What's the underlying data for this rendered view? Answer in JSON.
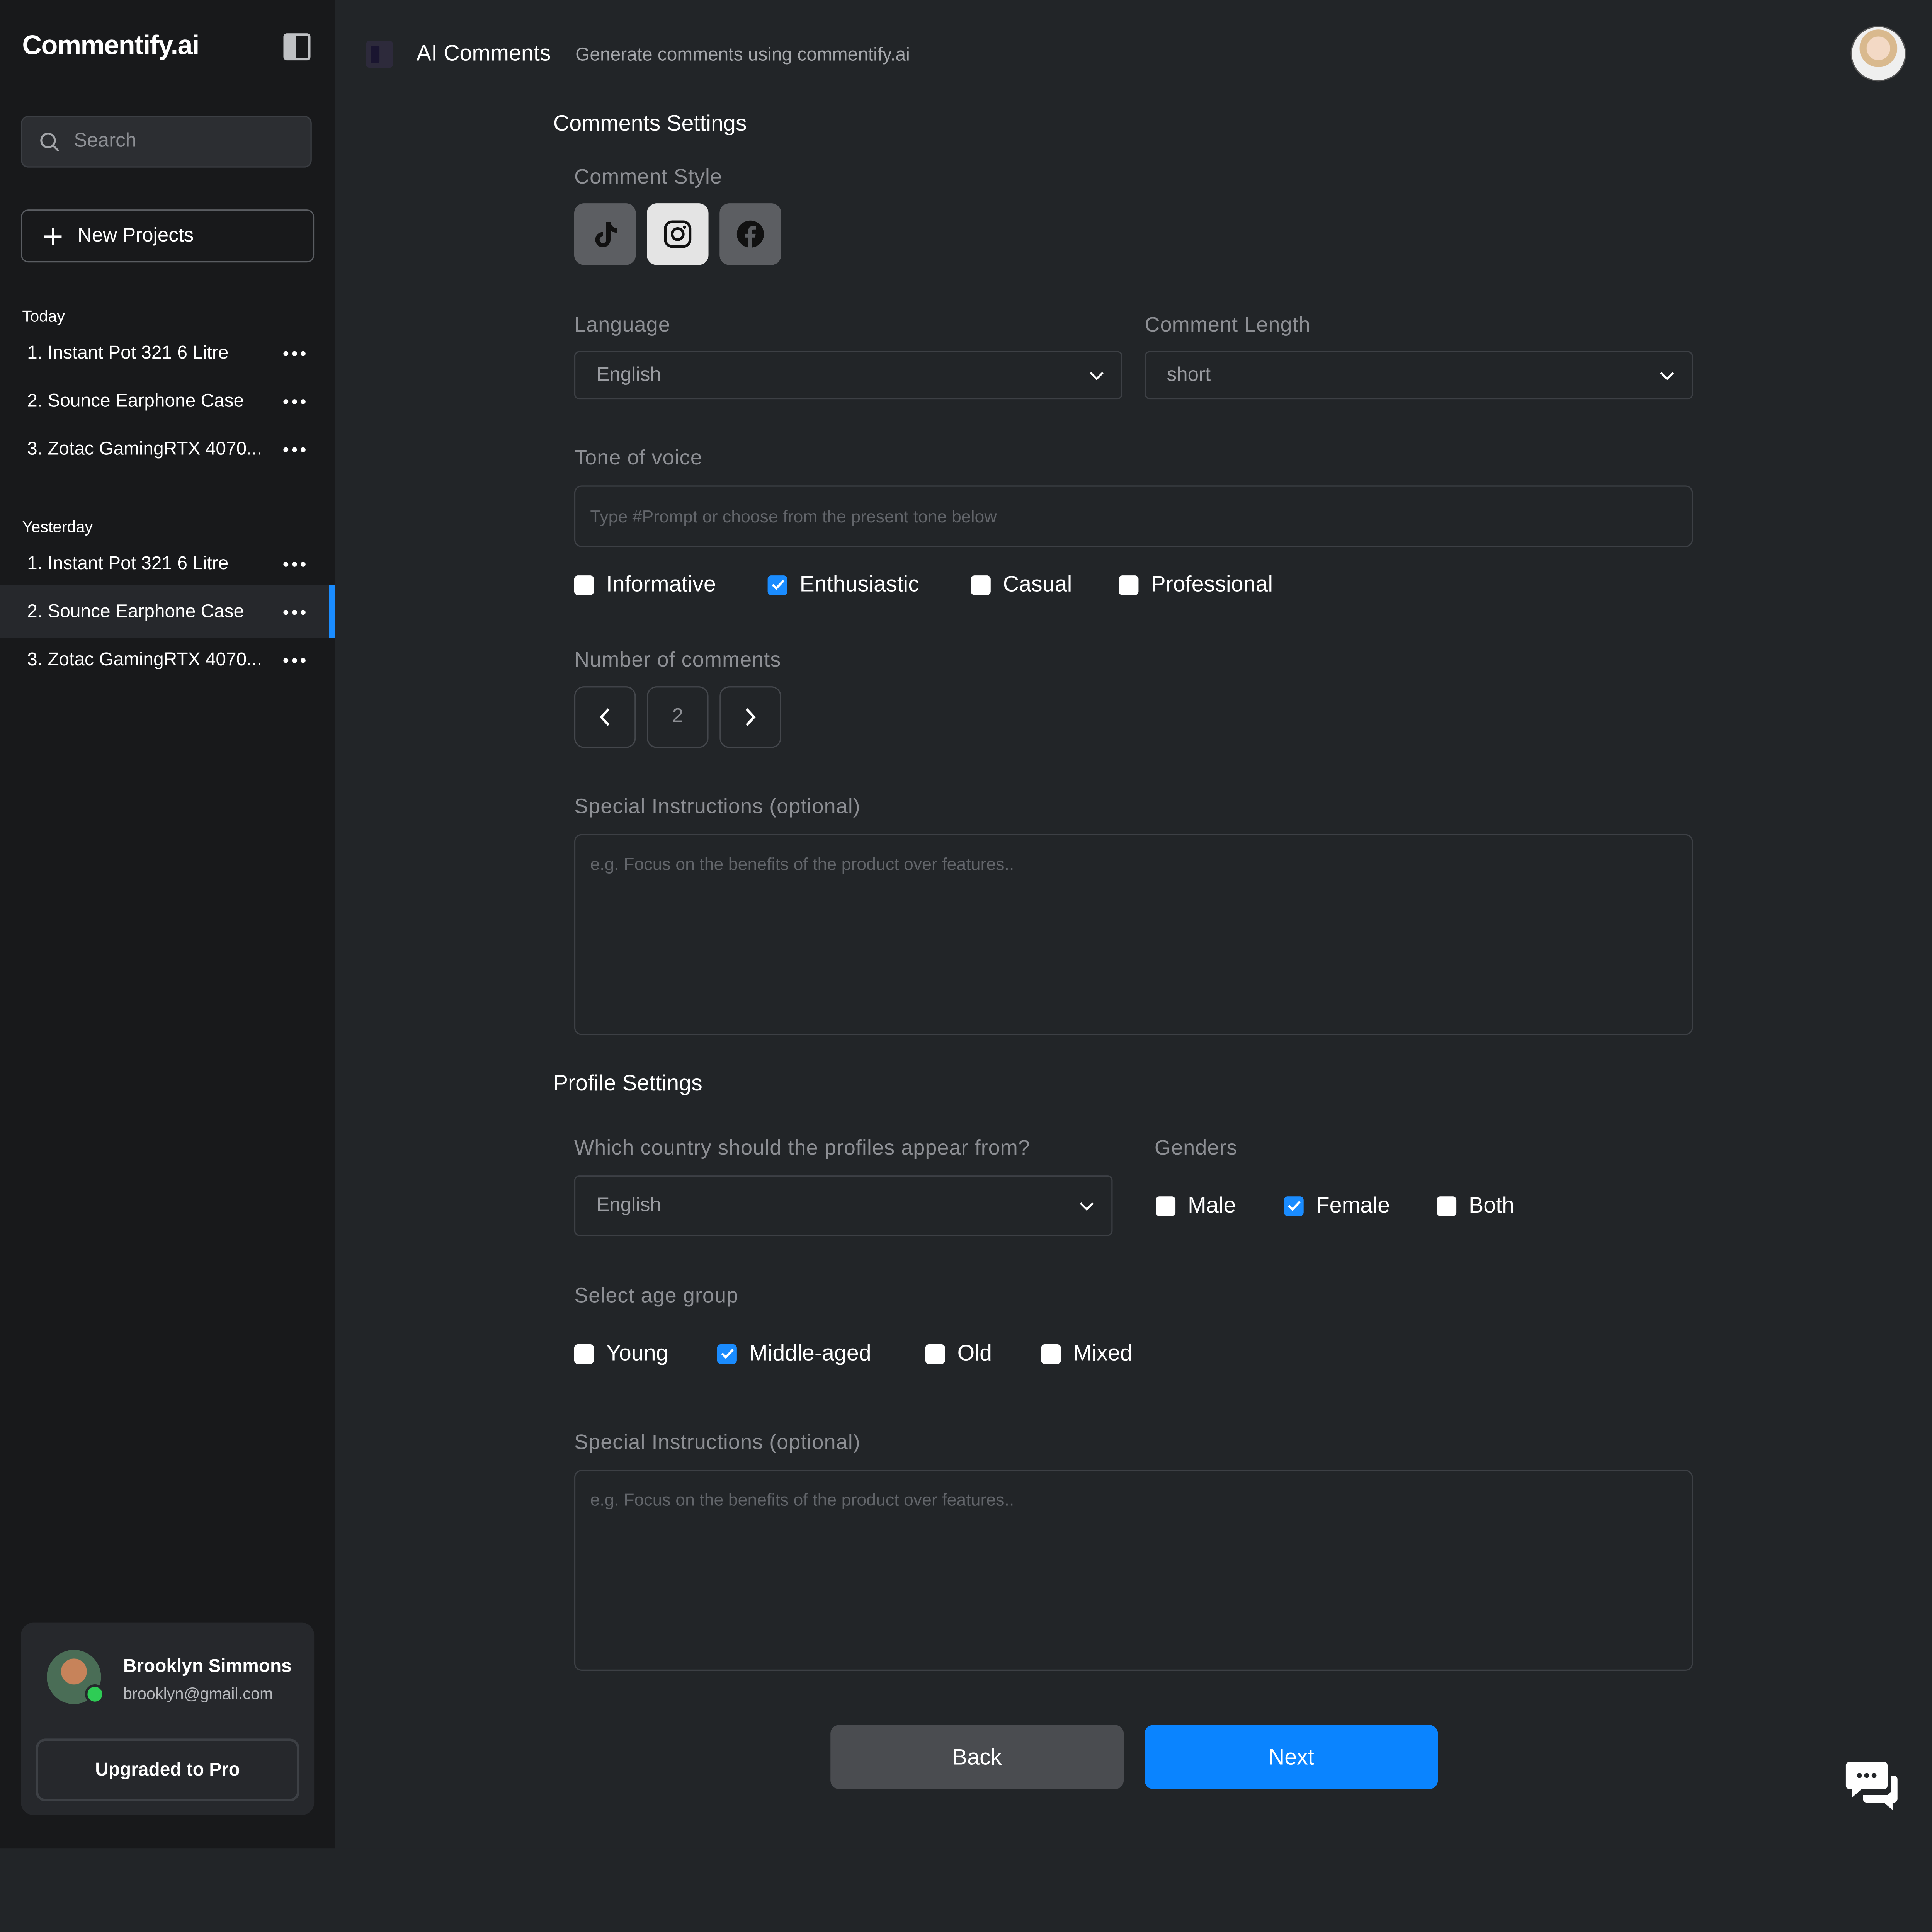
{
  "app": {
    "brand": "Commentify.ai"
  },
  "sidebar": {
    "search_placeholder": "Search",
    "new_project_label": "New Projects",
    "groups": [
      {
        "label": "Today",
        "items": [
          {
            "label": "1. Instant Pot 321 6 Litre"
          },
          {
            "label": "2. Sounce Earphone Case"
          },
          {
            "label": "3. Zotac GamingRTX 4070..."
          }
        ]
      },
      {
        "label": "Yesterday",
        "items": [
          {
            "label": "1. Instant Pot 321 6 Litre"
          },
          {
            "label": "2. Sounce Earphone Case",
            "active": true
          },
          {
            "label": "3. Zotac GamingRTX 4070..."
          }
        ]
      }
    ],
    "user": {
      "name": "Brooklyn Simmons",
      "email": "brooklyn@gmail.com",
      "upgrade_label": "Upgraded to Pro"
    }
  },
  "header": {
    "title": "AI Comments",
    "subtitle": "Generate comments using commentify.ai"
  },
  "comments_settings": {
    "title": "Comments Settings",
    "style_label": "Comment Style",
    "styles": [
      {
        "icon": "tiktok-icon",
        "selected": false
      },
      {
        "icon": "instagram-icon",
        "selected": true
      },
      {
        "icon": "facebook-icon",
        "selected": false
      }
    ],
    "language_label": "Language",
    "language_value": "English",
    "length_label": "Comment Length",
    "length_value": "short",
    "tone_label": "Tone of voice",
    "tone_placeholder": "Type #Prompt or choose from the present tone below",
    "tones": [
      {
        "label": "Informative",
        "checked": false
      },
      {
        "label": "Enthusiastic",
        "checked": true
      },
      {
        "label": "Casual",
        "checked": false
      },
      {
        "label": "Professional",
        "checked": false
      }
    ],
    "count_label": "Number of comments",
    "count_value": "2",
    "instructions_label": "Special Instructions (optional)",
    "instructions_placeholder": "e.g. Focus on the benefits of the product over features.."
  },
  "profile_settings": {
    "title": "Profile Settings",
    "country_label": "Which country should the profiles appear from?",
    "country_value": "English",
    "genders_label": "Genders",
    "genders": [
      {
        "label": "Male",
        "checked": false
      },
      {
        "label": "Female",
        "checked": true
      },
      {
        "label": "Both",
        "checked": false
      }
    ],
    "age_label": "Select age group",
    "ages": [
      {
        "label": "Young",
        "checked": false
      },
      {
        "label": "Middle-aged",
        "checked": true
      },
      {
        "label": "Old",
        "checked": false
      },
      {
        "label": "Mixed",
        "checked": false
      }
    ],
    "instructions_label": "Special Instructions (optional)",
    "instructions_placeholder": "e.g. Focus on the benefits of the product over features.."
  },
  "actions": {
    "back_label": "Back",
    "next_label": "Next"
  },
  "colors": {
    "accent": "#0a84ff",
    "background": "#222528",
    "sidebar": "#18191b"
  }
}
